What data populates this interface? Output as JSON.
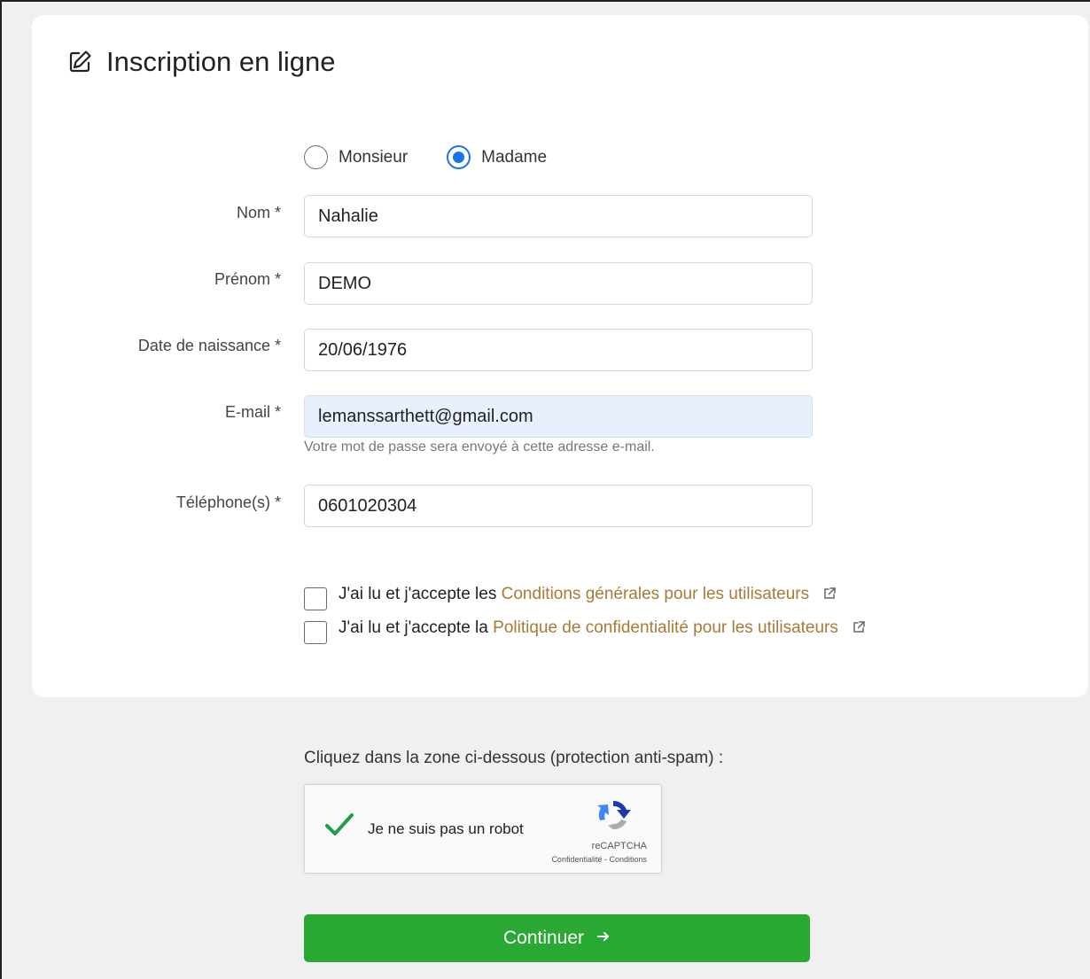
{
  "page": {
    "title": "Inscription en ligne",
    "title_icon": "edit-icon"
  },
  "civility": {
    "options": [
      {
        "label": "Monsieur",
        "checked": false
      },
      {
        "label": "Madame",
        "checked": true
      }
    ]
  },
  "fields": {
    "nom": {
      "label": "Nom *",
      "value": "Nahalie"
    },
    "prenom": {
      "label": "Prénom *",
      "value": "DEMO"
    },
    "birthdate": {
      "label": "Date de naissance *",
      "value": "20/06/1976"
    },
    "email": {
      "label": "E-mail *",
      "value": "lemanssarthett@gmail.com",
      "hint": "Votre mot de passe sera envoyé à cette adresse e-mail."
    },
    "phone": {
      "label": "Téléphone(s) *",
      "value": "0601020304"
    }
  },
  "consents": {
    "cgu": {
      "prefix": "J'ai lu et j'accepte les",
      "link": "Conditions générales pour les utilisateurs",
      "checked": false
    },
    "privacy": {
      "prefix": "J'ai lu et j'accepte la",
      "link": "Politique de confidentialité pour les utilisateurs",
      "checked": false
    },
    "link_color": "#a77a37"
  },
  "captcha": {
    "instruction": "Cliquez dans la zone ci-dessous (protection anti-spam) :",
    "label": "Je ne suis pas un robot",
    "brand": "reCAPTCHA",
    "terms": "Confidentialité - Conditions",
    "checked": true
  },
  "actions": {
    "continue_label": "Continuer",
    "continue_color": "#2aa834"
  }
}
